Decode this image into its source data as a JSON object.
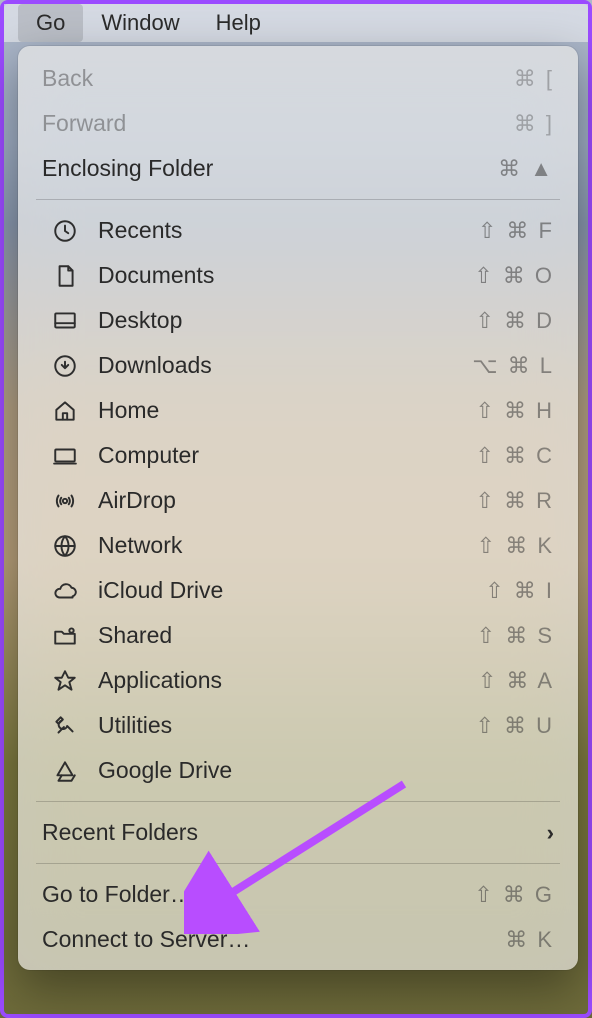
{
  "menubar": {
    "items": [
      {
        "label": "Go",
        "active": true
      },
      {
        "label": "Window",
        "active": false
      },
      {
        "label": "Help",
        "active": false
      }
    ]
  },
  "menu": {
    "nav": [
      {
        "label": "Back",
        "shortcut": "⌘ [",
        "disabled": true
      },
      {
        "label": "Forward",
        "shortcut": "⌘ ]",
        "disabled": true
      },
      {
        "label": "Enclosing Folder",
        "shortcut": "⌘ ▲",
        "disabled": false
      }
    ],
    "places": [
      {
        "label": "Recents",
        "shortcut": "⇧ ⌘ F",
        "icon": "clock"
      },
      {
        "label": "Documents",
        "shortcut": "⇧ ⌘ O",
        "icon": "document"
      },
      {
        "label": "Desktop",
        "shortcut": "⇧ ⌘ D",
        "icon": "desktop"
      },
      {
        "label": "Downloads",
        "shortcut": "⌥ ⌘ L",
        "icon": "download"
      },
      {
        "label": "Home",
        "shortcut": "⇧ ⌘ H",
        "icon": "home"
      },
      {
        "label": "Computer",
        "shortcut": "⇧ ⌘ C",
        "icon": "computer"
      },
      {
        "label": "AirDrop",
        "shortcut": "⇧ ⌘ R",
        "icon": "airdrop"
      },
      {
        "label": "Network",
        "shortcut": "⇧ ⌘ K",
        "icon": "network"
      },
      {
        "label": "iCloud Drive",
        "shortcut": "⇧ ⌘ I",
        "icon": "cloud"
      },
      {
        "label": "Shared",
        "shortcut": "⇧ ⌘ S",
        "icon": "shared"
      },
      {
        "label": "Applications",
        "shortcut": "⇧ ⌘ A",
        "icon": "applications"
      },
      {
        "label": "Utilities",
        "shortcut": "⇧ ⌘ U",
        "icon": "utilities"
      },
      {
        "label": "Google Drive",
        "shortcut": "",
        "icon": "gdrive"
      }
    ],
    "recent": {
      "label": "Recent Folders",
      "submenu": true
    },
    "actions": [
      {
        "label": "Go to Folder…",
        "shortcut": "⇧ ⌘ G"
      },
      {
        "label": "Connect to Server…",
        "shortcut": "⌘ K"
      }
    ]
  },
  "annotation": {
    "color": "#b84dff"
  }
}
